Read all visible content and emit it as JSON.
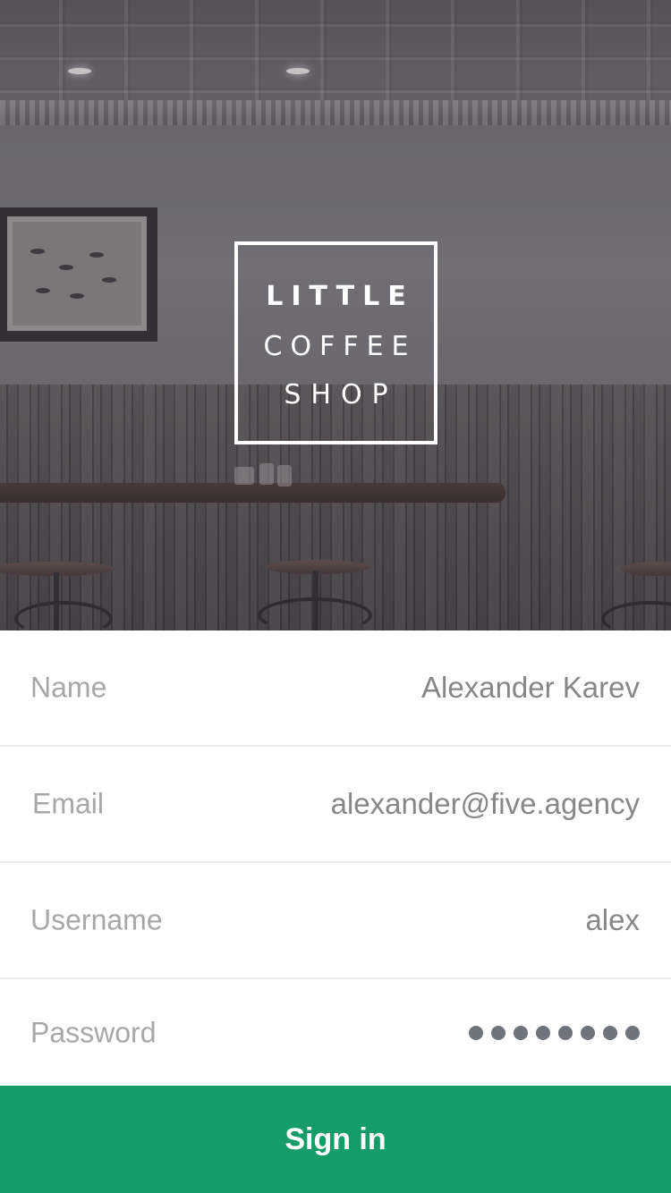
{
  "logo": {
    "line1": "LITTLE",
    "line2": "COFFEE",
    "line3": "SHOP"
  },
  "form": {
    "fields": [
      {
        "label": "Name",
        "value": "Alexander Karev"
      },
      {
        "label": "Email",
        "value": "alexander@five.agency"
      },
      {
        "label": "Username",
        "value": "alex"
      },
      {
        "label": "Password",
        "masked_length": 8
      }
    ]
  },
  "button": {
    "label": "Sign in"
  },
  "colors": {
    "accent": "#169c69",
    "label": "#a7a7a9",
    "value": "#87878a",
    "password_dot": "#6f737c"
  }
}
